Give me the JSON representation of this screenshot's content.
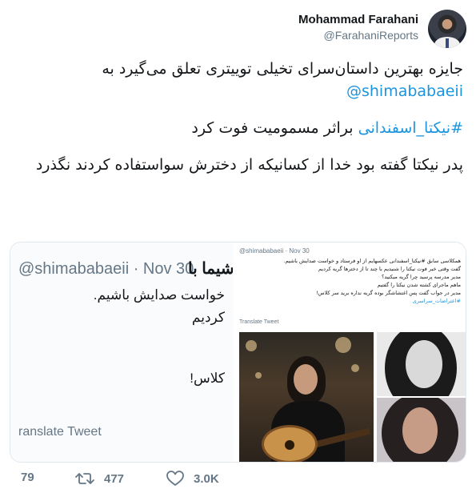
{
  "author": {
    "display_name": "Mohammad Farahani",
    "handle": "@FarahaniReports"
  },
  "tweet": {
    "line1": "جایزه بهترین داستان‌سرای تخیلی توییتری تعلق می‌گیرد به",
    "mention": "@shimababaeii",
    "hashtag": "#نیکتا_اسفندانی",
    "line2_rest": " براثر مسمومیت فوت کرد",
    "line3": "پدر نیکتا گفته بود خدا از کسانیکه از دخترش سواستفاده کردند نگذرد"
  },
  "media_left": {
    "handle_date": "@shimababaeii · Nov 30",
    "name_fragment": "شیما با",
    "text1": "خواست صدایش باشیم.",
    "text2": "کردیم",
    "text3": "کلاس!",
    "translate": "ranslate Tweet"
  },
  "media_right": {
    "header": "@shimababaeii · Nov 30",
    "lines": [
      "همکلاسی سابق #نیکتا_اسفندانی عکسهایم از او فرستاد و خواست صدایش باشیم.",
      "گفت وقتی خبر فوت نیکتا را شنیدیم با چند تا از دخترها گریه کردیم",
      "مدیر مدرسه پرسید چرا گریه میکنید؟",
      "ماهم ماجرای کشته شدن نیکتا را گفتیم",
      "مدیر در جواب گفت پس اغتشاشگر بوده گریه نداره برید سر کلاس!",
      "#اعتراضات_سراسری"
    ],
    "translate": "Translate Tweet"
  },
  "actions": {
    "replies": "79",
    "retweets": "477",
    "likes": "3.0K"
  },
  "colors": {
    "link": "#1b95e0",
    "muted": "#657786",
    "text": "#14171a"
  }
}
